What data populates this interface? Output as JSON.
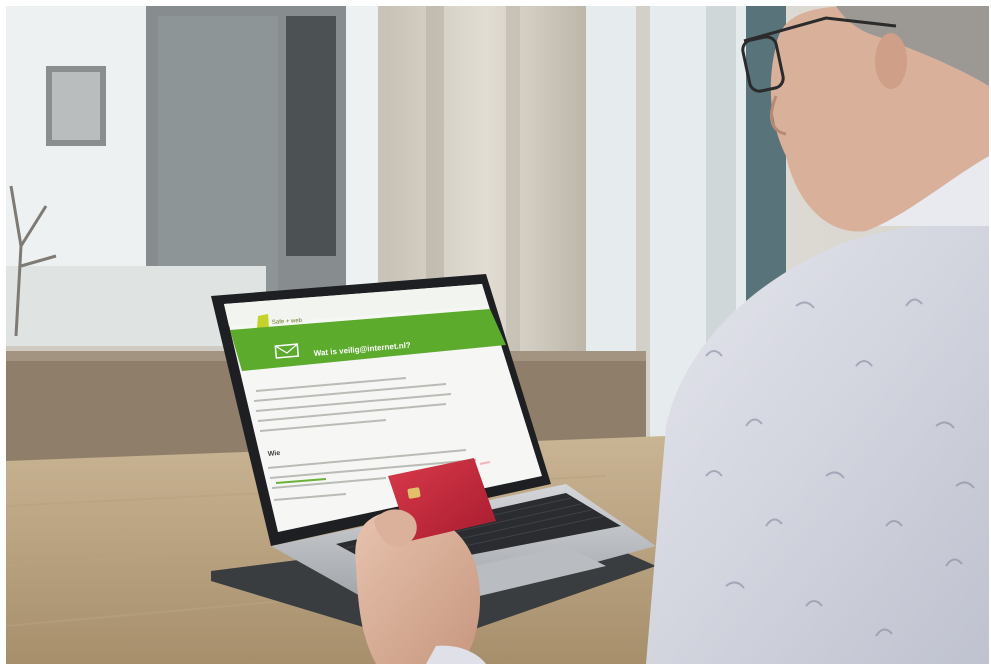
{
  "photo": {
    "subject": "older man using laptop holding red bank card",
    "screen": {
      "brand": "Safe + web",
      "banner_heading": "Wat is veilig@internet.nl?",
      "section_heading": "Wie"
    }
  }
}
